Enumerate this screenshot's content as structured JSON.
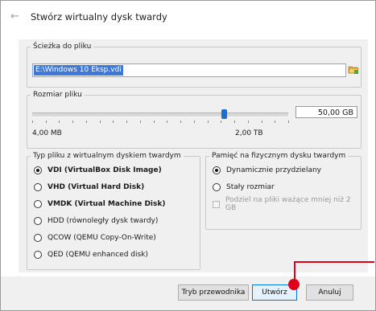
{
  "dialog": {
    "title": "Stwórz wirtualny dysk twardy"
  },
  "path_group": {
    "legend": "Ścieżka do pliku",
    "value": "E:\\Windows 10 Eksp.vdi"
  },
  "size_group": {
    "legend": "Rozmiar pliku",
    "min_label": "4,00 MB",
    "max_label": "2,00 TB",
    "value": "50,00 GB",
    "slider_fraction": 0.75
  },
  "type_group": {
    "legend": "Typ pliku z wirtualnym dyskiem twardym",
    "options": [
      {
        "label": "VDI (VirtualBox Disk Image)",
        "checked": true
      },
      {
        "label": "VHD (Virtual Hard Disk)",
        "checked": false
      },
      {
        "label": "VMDK (Virtual Machine Disk)",
        "checked": false
      },
      {
        "label": "HDD (równoległy dysk twardy)",
        "checked": false
      },
      {
        "label": "QCOW (QEMU Copy-On-Write)",
        "checked": false
      },
      {
        "label": "QED (QEMU enhanced disk)",
        "checked": false
      }
    ]
  },
  "storage_group": {
    "legend": "Pamięć na fizycznym dysku twardym",
    "dynamic_label": "Dynamicznie przydzielany",
    "fixed_label": "Stały rozmiar",
    "split_label": "Podziel na pliki ważące mniej niż 2 GB"
  },
  "footer": {
    "guided_label": "Tryb przewodnika",
    "create_label": "Utwórz",
    "cancel_label": "Anuluj"
  },
  "colors": {
    "accent": "#0078d7",
    "annotation": "#e0001a"
  }
}
